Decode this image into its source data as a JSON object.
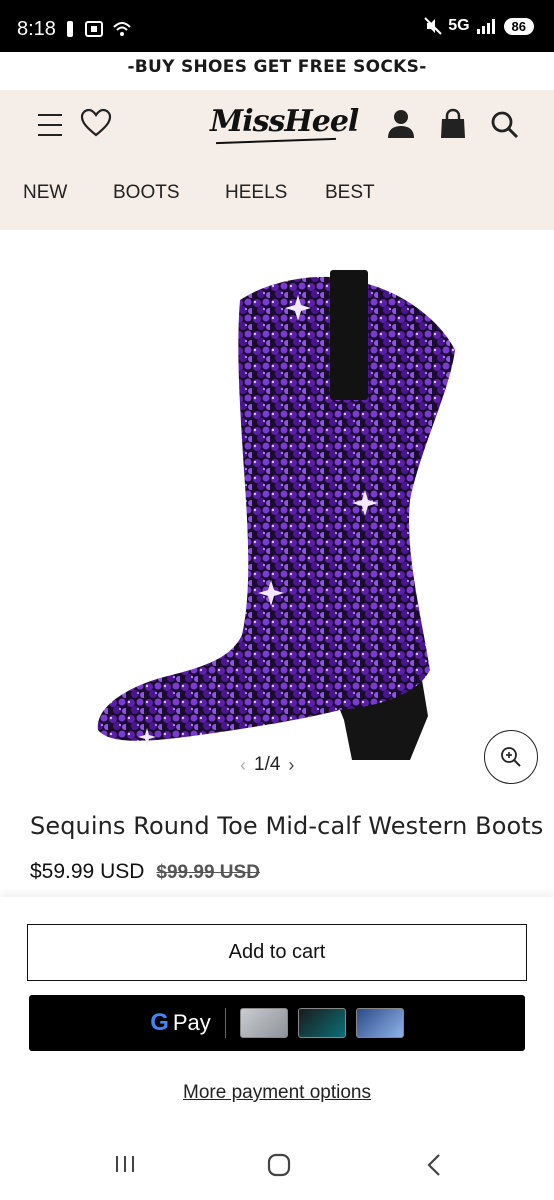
{
  "status_bar": {
    "time": "8:18",
    "network": "5G",
    "battery": "86"
  },
  "promo": {
    "text": "-BUY SHOES GET FREE SOCKS-"
  },
  "header": {
    "logo": "MissHeel",
    "nav": [
      "NEW",
      "BOOTS",
      "HEELS",
      "BEST"
    ]
  },
  "product": {
    "image_pager": "1/4",
    "title": "Sequins Round Toe Mid-calf Western Boots",
    "price": "$59.99 USD",
    "compare_price": "$99.99 USD"
  },
  "actions": {
    "add_to_cart": "Add to cart",
    "gpay_label": "Pay",
    "gpay_g": "G",
    "more_payment_options": "More payment options"
  },
  "colors": {
    "header_bg": "#f5eee8",
    "sequin_purple": "#5b1fa8",
    "gpay_bg": "#000000"
  }
}
